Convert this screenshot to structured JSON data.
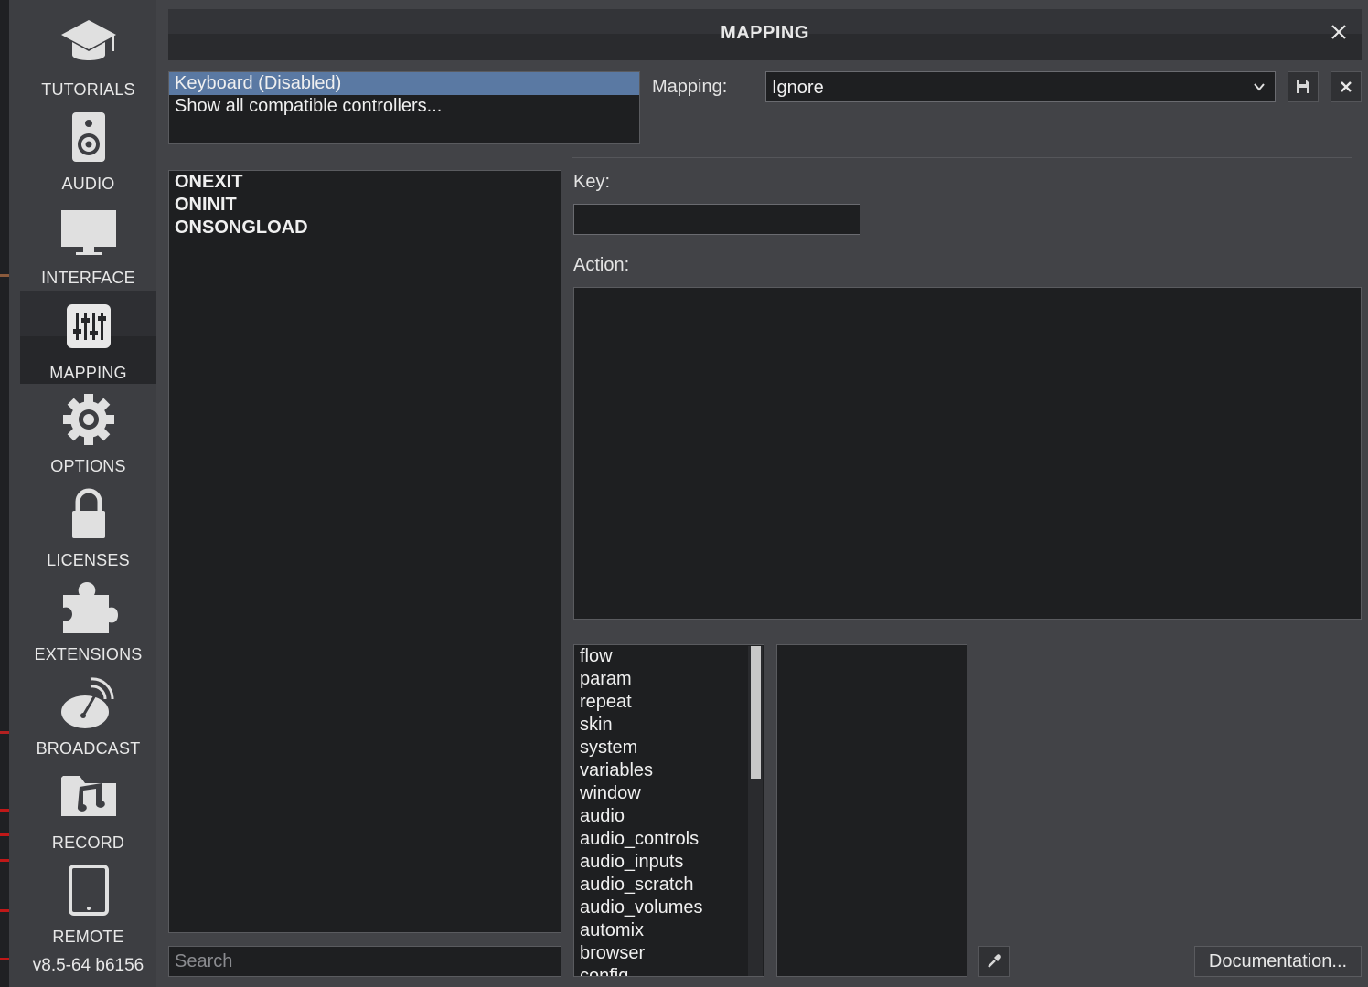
{
  "sidebar": {
    "items": [
      {
        "label": "TUTORIALS",
        "icon": "graduation-cap-icon"
      },
      {
        "label": "AUDIO",
        "icon": "speaker-icon"
      },
      {
        "label": "INTERFACE",
        "icon": "monitor-icon"
      },
      {
        "label": "MAPPING",
        "icon": "sliders-icon",
        "active": true
      },
      {
        "label": "OPTIONS",
        "icon": "gear-icon"
      },
      {
        "label": "LICENSES",
        "icon": "lock-icon"
      },
      {
        "label": "EXTENSIONS",
        "icon": "puzzle-icon"
      },
      {
        "label": "BROADCAST",
        "icon": "satellite-dish-icon"
      },
      {
        "label": "RECORD",
        "icon": "music-folder-icon"
      },
      {
        "label": "REMOTE",
        "icon": "tablet-icon"
      }
    ],
    "version": "v8.5-64 b6156"
  },
  "dialog": {
    "title": "MAPPING",
    "controllers": [
      "Keyboard (Disabled)",
      "Show all compatible controllers..."
    ],
    "selected_controller": "Keyboard (Disabled)",
    "mapping_label": "Mapping:",
    "mapping_value": "Ignore",
    "keys": [
      "ONEXIT",
      "ONINIT",
      "ONSONGLOAD"
    ],
    "key_label": "Key:",
    "key_value": "",
    "action_label": "Action:",
    "verbs": [
      "flow",
      "param",
      "repeat",
      "skin",
      "system",
      "variables",
      "window",
      "audio",
      "audio_controls",
      "audio_inputs",
      "audio_scratch",
      "audio_volumes",
      "automix",
      "browser",
      "config"
    ],
    "search_placeholder": "Search",
    "documentation_label": "Documentation..."
  },
  "colors": {
    "background": "#424347",
    "panel": "#1e1f21",
    "selection": "#5a79a3",
    "active_sidebar": "#26272a"
  }
}
